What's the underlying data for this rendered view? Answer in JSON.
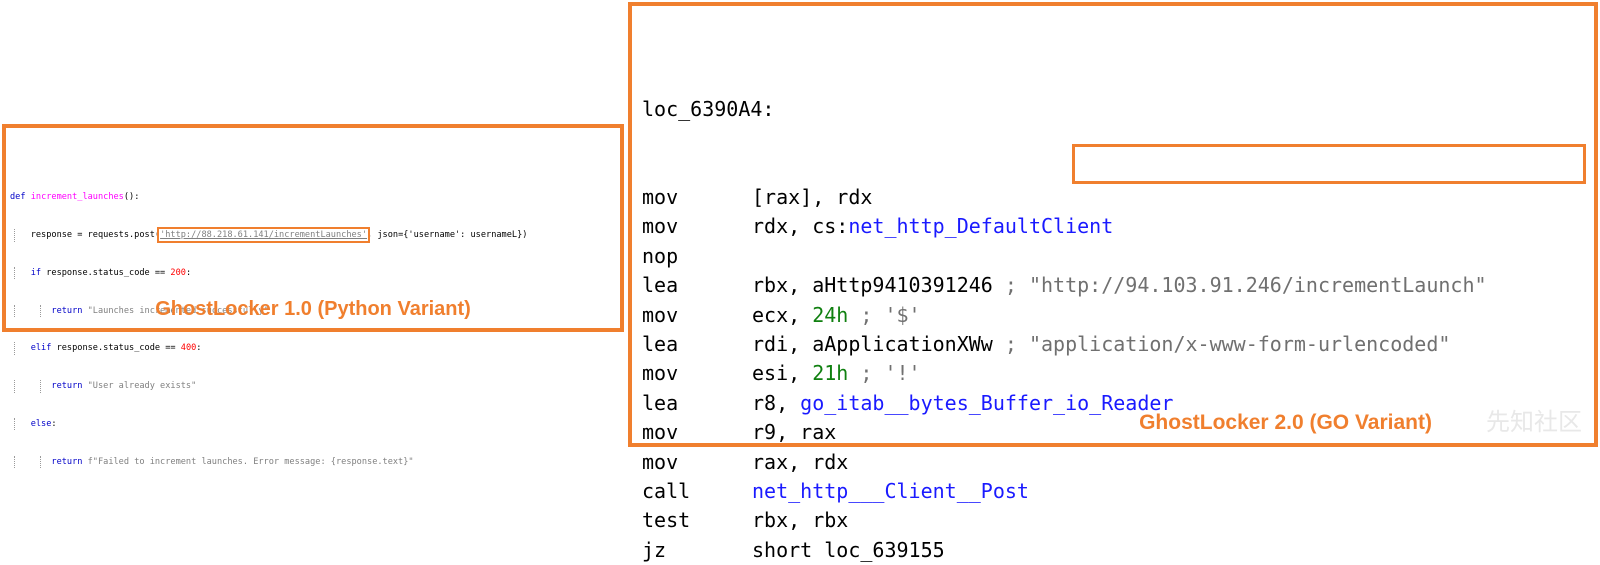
{
  "python_panel": {
    "label": "GhostLocker 1.0 (Python Variant)",
    "lines": {
      "l1_kw": "def",
      "l1_fn": "increment_launches",
      "l1_rest": "():",
      "l2_pre": "response = requests.post(",
      "l2_url": "'http://88.218.61.141/incrementLaunches'",
      "l2_post": ", json={'username': usernameL})",
      "l3_kw": "if",
      "l3_mid": " response.status_code == ",
      "l3_num": "200",
      "l3_end": ":",
      "l4_kw": "return",
      "l4_str": " \"Launches incremented successfully\"",
      "l5_kw": "elif",
      "l5_mid": " response.status_code == ",
      "l5_num": "400",
      "l5_end": ":",
      "l6_kw": "return",
      "l6_str": " \"User already exists\"",
      "l7_kw": "else",
      "l7_end": ":",
      "l8_kw": "return",
      "l8_str": " f\"Failed to increment launches. Error message: {response.text}\""
    }
  },
  "go_panel": {
    "label": "GhostLocker 2.0 (GO Variant)",
    "watermark": "先知社区",
    "label_line": "loc_6390A4:",
    "lines": [
      {
        "m": "mov",
        "a": "[rax], rdx"
      },
      {
        "m": "mov",
        "a": "rdx, cs:",
        "b": "net_http_DefaultClient"
      },
      {
        "m": "nop"
      },
      {
        "m": "lea",
        "a": "rbx, aHttp9410391246 ",
        "c": "; ",
        "s": "\"http://94.103.91.246/incrementLaunch\""
      },
      {
        "m": "mov",
        "a": "ecx, ",
        "n": "24h",
        "c": " ; '$'"
      },
      {
        "m": "lea",
        "a": "rdi, aApplicationXWw ",
        "c": "; ",
        "s": "\"application/x-www-form-urlencoded\""
      },
      {
        "m": "mov",
        "a": "esi, ",
        "n": "21h",
        "c": " ; '!'"
      },
      {
        "m": "lea",
        "a": "r8, ",
        "b": "go_itab__bytes_Buffer_io_Reader"
      },
      {
        "m": "mov",
        "a": "r9, rax"
      },
      {
        "m": "mov",
        "a": "rax, rdx"
      },
      {
        "m": "call",
        "b": "net_http___Client__Post"
      },
      {
        "m": "test",
        "a": "rbx, rbx"
      },
      {
        "m": "jz",
        "a": "short loc_639155"
      }
    ]
  }
}
